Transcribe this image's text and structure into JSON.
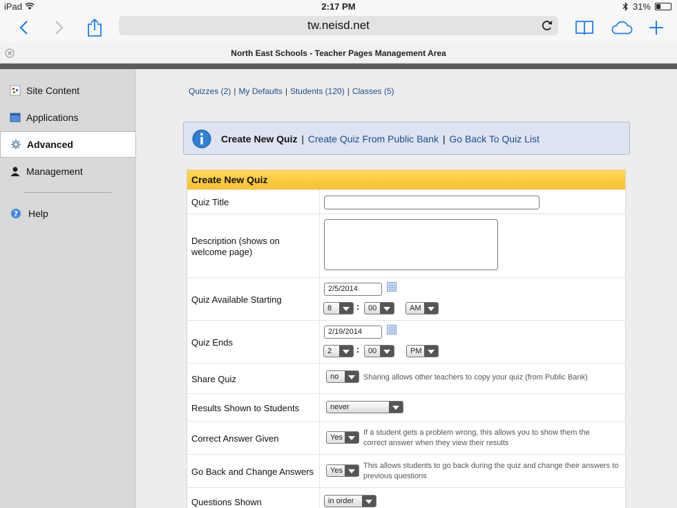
{
  "status": {
    "device": "iPad",
    "time": "2:17 PM",
    "battery": "31%"
  },
  "browser": {
    "url": "tw.neisd.net",
    "tab_title": "North East Schools - Teacher Pages Management Area"
  },
  "sidebar": {
    "items": [
      {
        "label": "Site Content"
      },
      {
        "label": "Applications"
      },
      {
        "label": "Advanced"
      },
      {
        "label": "Management"
      },
      {
        "label": "Help"
      }
    ]
  },
  "quicklinks": {
    "quizzes": "Quizzes (2)",
    "defaults": "My Defaults",
    "students": "Students (120)",
    "classes": "Classes (5)",
    "sep": "|"
  },
  "infobar": {
    "current": "Create New Quiz",
    "from_bank": "Create Quiz From Public Bank",
    "back": "Go Back To Quiz List",
    "sep": "|"
  },
  "form": {
    "header": "Create New Quiz",
    "quiz_title_label": "Quiz Title",
    "quiz_title_value": "",
    "description_label": "Description (shows on welcome page)",
    "start_label": "Quiz Available Starting",
    "start_date": "2/5/2014",
    "start_hour": "8",
    "start_min": "00",
    "start_ampm": "AM",
    "end_label": "Quiz Ends",
    "end_date": "2/19/2014",
    "end_hour": "2",
    "end_min": "00",
    "end_ampm": "PM",
    "colon": ":",
    "share_label": "Share Quiz",
    "share_value": "no",
    "share_help": "Sharing allows other teachers to copy your quiz (from Public Bank)",
    "results_label": "Results Shown to Students",
    "results_value": "never",
    "correct_label": "Correct Answer Given",
    "correct_value": "Yes",
    "correct_help": "If a student gets a problem wrong, this allows you to show them the correct answer when they view their results",
    "goback_label": "Go Back and Change Answers",
    "goback_value": "Yes",
    "goback_help": "This allows students to go back during the quiz and change their answers to previous questions",
    "questions_label": "Questions Shown",
    "questions_value": "in order"
  }
}
